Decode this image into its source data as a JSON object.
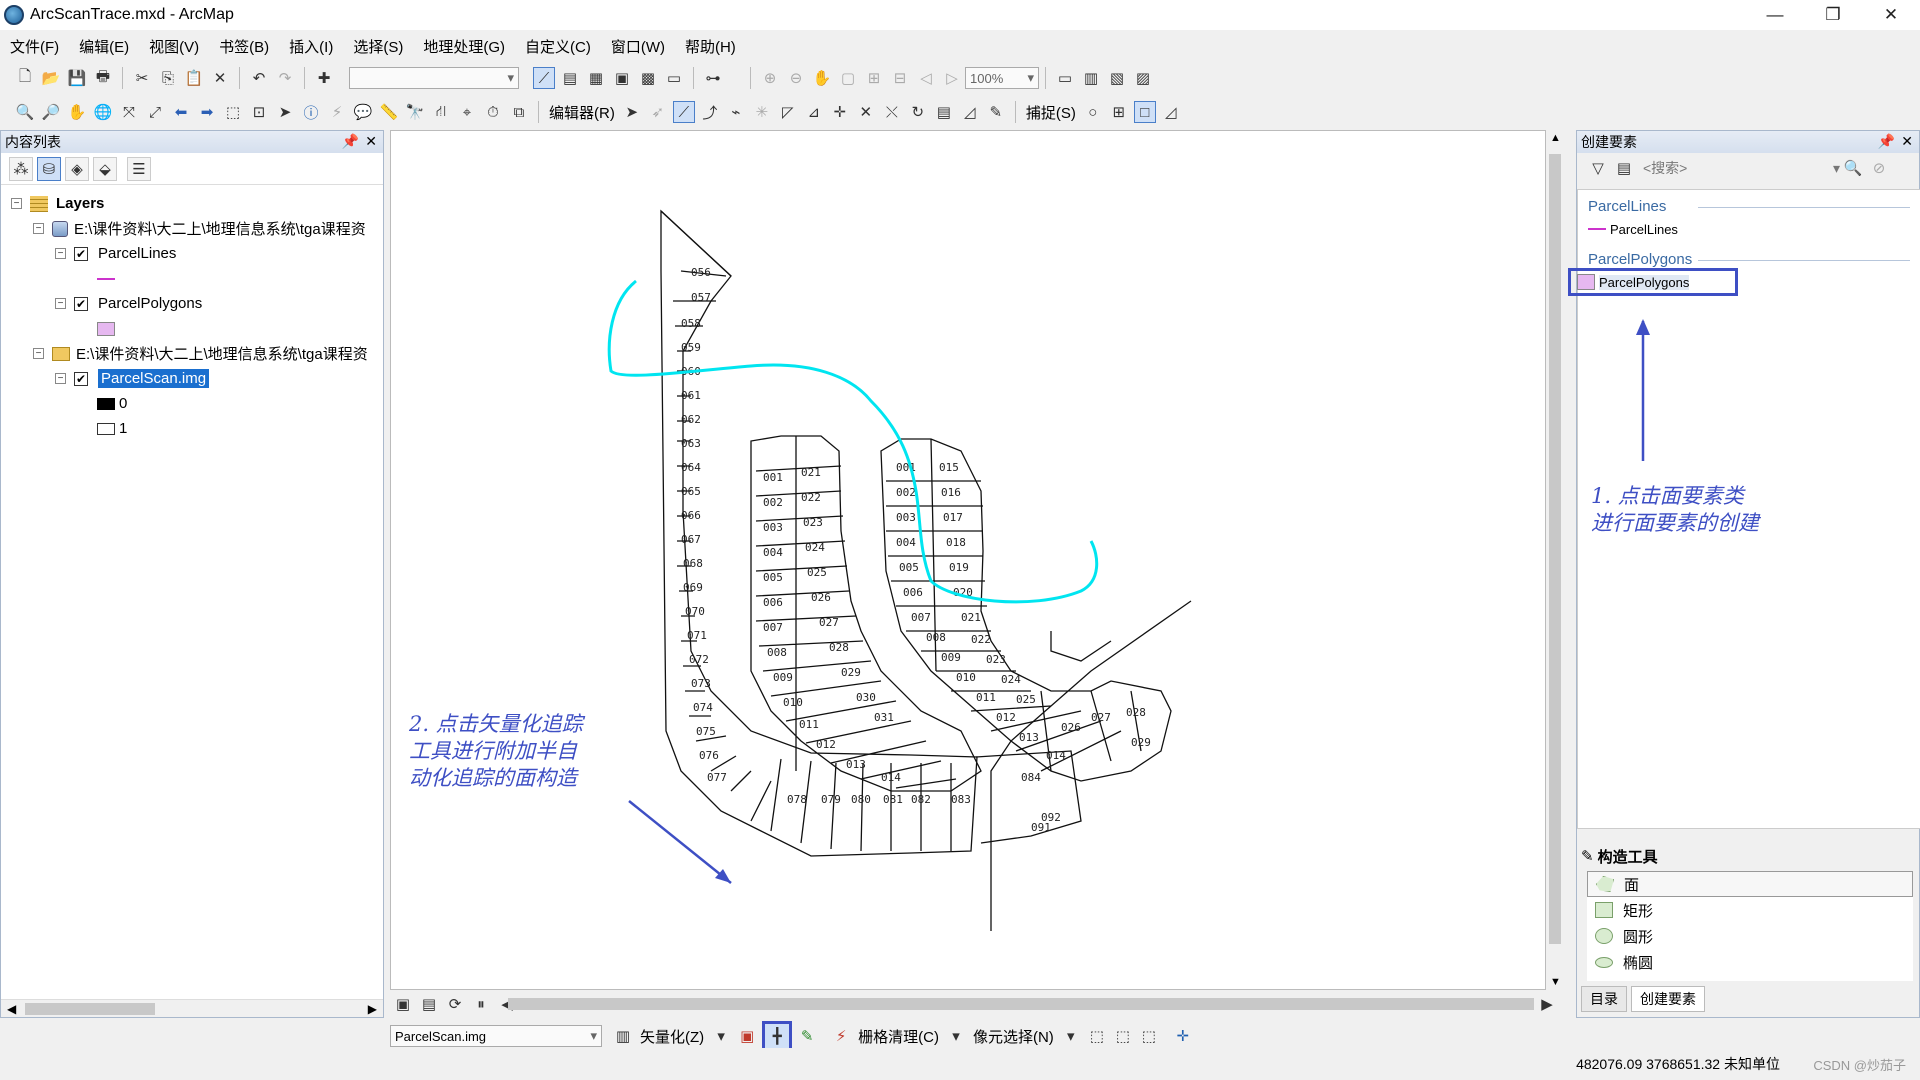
{
  "window": {
    "title": "ArcScanTrace.mxd - ArcMap",
    "controls": {
      "minimize": "—",
      "maximize": "❐",
      "close": "✕"
    }
  },
  "menu": [
    "文件(F)",
    "编辑(E)",
    "视图(V)",
    "书签(B)",
    "插入(I)",
    "选择(S)",
    "地理处理(G)",
    "自定义(C)",
    "窗口(W)",
    "帮助(H)"
  ],
  "standard_toolbar": {
    "zoom": "100%"
  },
  "editor_toolbar": {
    "editor_label": "编辑器(R)",
    "snapping_label": "捕捉(S)"
  },
  "toc": {
    "title": "内容列表",
    "root": "Layers",
    "groups": [
      {
        "path": "E:\\课件资料\\大二上\\地理信息系统\\tga课程资",
        "layers": [
          "ParcelLines",
          "ParcelPolygons"
        ]
      },
      {
        "path": "E:\\课件资料\\大二上\\地理信息系统\\tga课程资",
        "layers": [
          "ParcelScan.img"
        ],
        "values": [
          "0",
          "1"
        ]
      }
    ]
  },
  "create_features": {
    "title": "创建要素",
    "search_placeholder": "<搜索>",
    "groups": [
      {
        "name": "ParcelLines",
        "template": "ParcelLines"
      },
      {
        "name": "ParcelPolygons",
        "template": "ParcelPolygons"
      }
    ],
    "construction_tools_title": "构造工具",
    "construction_tools": [
      "面",
      "矩形",
      "圆形",
      "椭圆"
    ],
    "tabs": [
      "目录",
      "创建要素"
    ]
  },
  "annotations": {
    "step1": "1. 点击面要素类\n进行面要素的创建",
    "step2": "2. 点击矢量化追踪\n工具进行附加半自\n动化追踪的面构造"
  },
  "arcscan_toolbar": {
    "raster_layer": "ParcelScan.img",
    "vectorization_label": "矢量化(Z)",
    "raster_cleanup_label": "栅格清理(C)",
    "cell_selection_label": "像元选择(N)"
  },
  "status": {
    "coordinates": "482076.09  3768651.32 未知单位",
    "watermark": "CSDN @炒茄子"
  },
  "colors": {
    "accent": "#3e4fc4",
    "trace": "#00e5f0",
    "selection": "#1a6fcf",
    "polygon_fill": "#e6b8f0"
  }
}
